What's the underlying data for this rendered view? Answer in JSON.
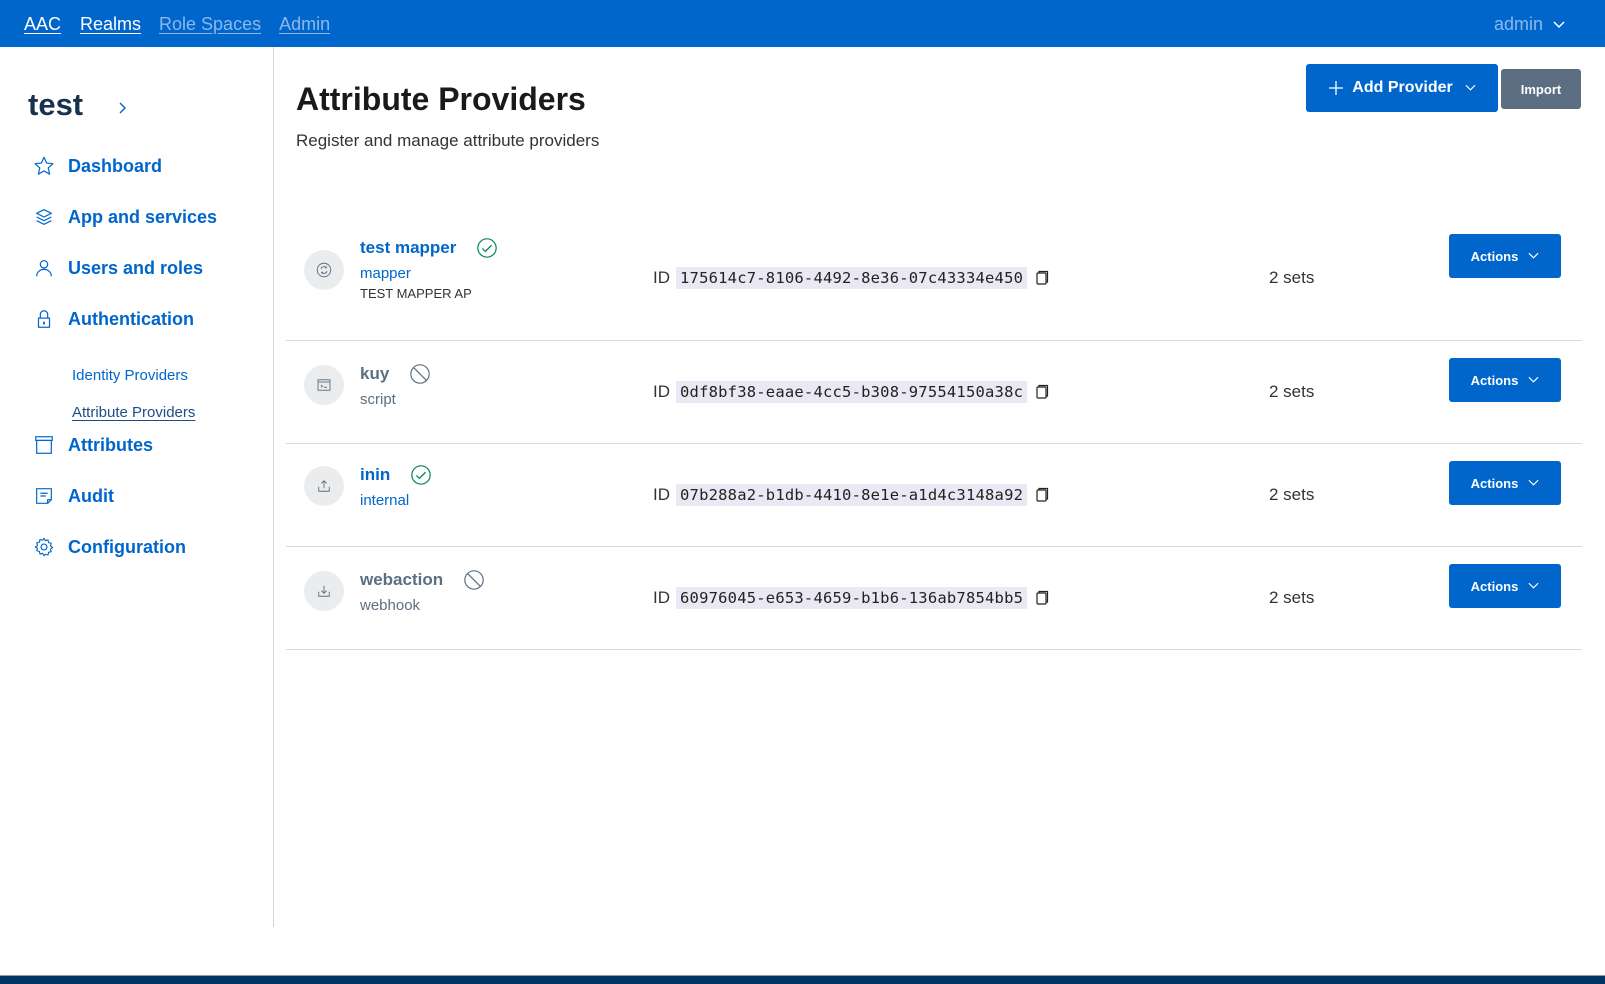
{
  "header": {
    "brand": "AAC",
    "nav": [
      {
        "label": "Realms",
        "active": true
      },
      {
        "label": "Role Spaces",
        "active": false
      },
      {
        "label": "Admin",
        "active": false
      }
    ],
    "user": "admin"
  },
  "sidebar": {
    "realm": "test",
    "items": [
      {
        "label": "Dashboard",
        "icon": "star-icon"
      },
      {
        "label": "App and services",
        "icon": "layers-icon"
      },
      {
        "label": "Users and roles",
        "icon": "user-icon"
      },
      {
        "label": "Authentication",
        "icon": "lock-icon"
      },
      {
        "label": "Attributes",
        "icon": "archive-icon"
      },
      {
        "label": "Audit",
        "icon": "note-icon"
      },
      {
        "label": "Configuration",
        "icon": "gear-icon"
      }
    ],
    "subitems": [
      {
        "label": "Identity Providers",
        "active": false
      },
      {
        "label": "Attribute Providers",
        "active": true
      }
    ]
  },
  "main": {
    "title": "Attribute Providers",
    "subtitle": "Register and manage attribute providers",
    "add_button": "Add Provider",
    "import_button": "Import",
    "id_label": "ID",
    "actions_label": "Actions",
    "providers": [
      {
        "name": "test mapper",
        "type": "mapper",
        "description": "TEST MAPPER AP",
        "status": "enabled",
        "id": "175614c7-8106-4492-8e36-07c43334e450",
        "sets": "2 sets",
        "icon": "mapper-icon"
      },
      {
        "name": "kuy",
        "type": "script",
        "description": "",
        "status": "disabled",
        "id": "0df8bf38-eaae-4cc5-b308-97554150a38c",
        "sets": "2 sets",
        "icon": "script-icon"
      },
      {
        "name": "inin",
        "type": "internal",
        "description": "",
        "status": "enabled",
        "id": "07b288a2-b1db-4410-8e1e-a1d4c3148a92",
        "sets": "2 sets",
        "icon": "upload-icon"
      },
      {
        "name": "webaction",
        "type": "webhook",
        "description": "",
        "status": "disabled",
        "id": "60976045-e653-4659-b1b6-136ab7854bb5",
        "sets": "2 sets",
        "icon": "download-icon"
      }
    ]
  },
  "colors": {
    "primary": "#0066cc",
    "secondary": "#5c6f82",
    "success": "#008758",
    "footer": "#003366"
  }
}
